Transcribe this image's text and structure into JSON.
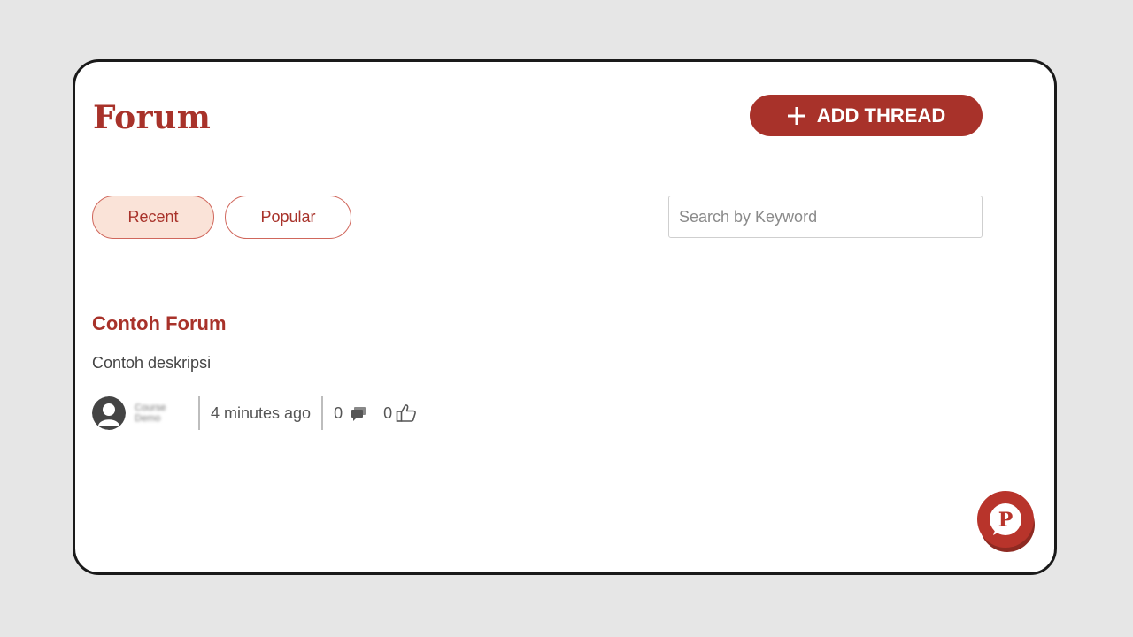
{
  "header": {
    "title": "Forum",
    "add_thread_label": "ADD THREAD"
  },
  "tabs": [
    {
      "label": "Recent",
      "active": true
    },
    {
      "label": "Popular",
      "active": false
    }
  ],
  "search": {
    "placeholder": "Search by Keyword",
    "value": ""
  },
  "threads": [
    {
      "title": "Contoh Forum",
      "description": "Contoh deskripsi",
      "author": "Course Demo",
      "time": "4 minutes ago",
      "comments": "0",
      "likes": "0"
    }
  ],
  "icons": {
    "add": "plus-icon",
    "comments": "comment-icon",
    "likes": "thumbs-up-icon",
    "avatar": "user-avatar-icon",
    "chat": "chat-widget-icon"
  },
  "colors": {
    "brand": "#a8322a",
    "tab_active_bg": "#fae3d8",
    "page_bg": "#e6e6e6"
  }
}
